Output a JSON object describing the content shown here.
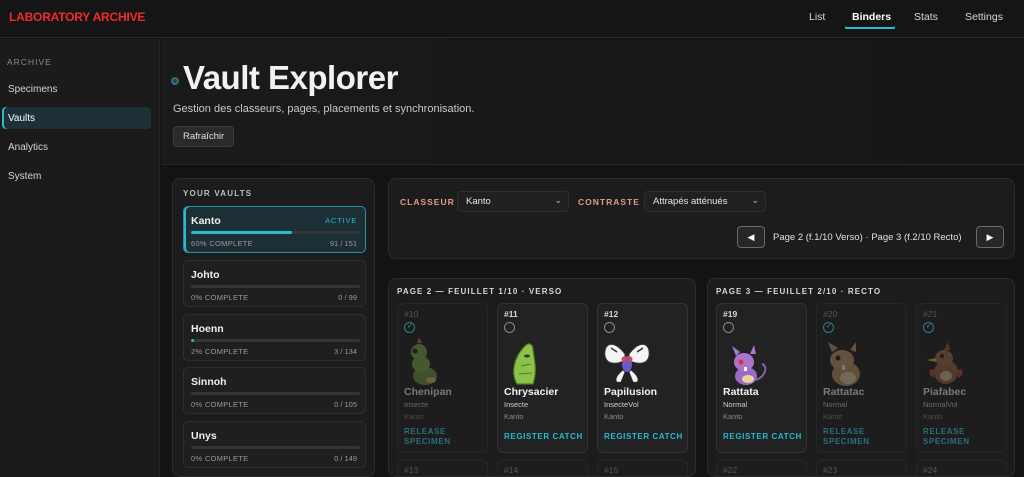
{
  "brand": "LABORATORY ARCHIVE",
  "nav": [
    {
      "label": "List",
      "active": false
    },
    {
      "label": "Binders",
      "active": true
    },
    {
      "label": "Stats",
      "active": false
    },
    {
      "label": "Settings",
      "active": false
    }
  ],
  "sidebar": {
    "heading": "ARCHIVE",
    "items": [
      {
        "label": "Specimens",
        "active": false
      },
      {
        "label": "Vaults",
        "active": true
      },
      {
        "label": "Analytics",
        "active": false
      },
      {
        "label": "System",
        "active": false
      }
    ]
  },
  "header": {
    "title": "Vault Explorer",
    "subtitle": "Gestion des classeurs, pages, placements et synchronisation.",
    "refresh_label": "Rafraîchir"
  },
  "vaults": {
    "heading": "YOUR VAULTS",
    "active_badge": "ACTIVE",
    "items": [
      {
        "name": "Kanto",
        "active": true,
        "progress": 0.6,
        "pct_label": "60% COMPLETE",
        "count": "91 / 151"
      },
      {
        "name": "Johto",
        "active": false,
        "progress": 0.0,
        "pct_label": "0% COMPLETE",
        "count": "0 / 99"
      },
      {
        "name": "Hoenn",
        "active": false,
        "progress": 0.02,
        "pct_label": "2% COMPLETE",
        "count": "3 / 134"
      },
      {
        "name": "Sinnoh",
        "active": false,
        "progress": 0.0,
        "pct_label": "0% COMPLETE",
        "count": "0 / 105"
      },
      {
        "name": "Unys",
        "active": false,
        "progress": 0.0,
        "pct_label": "0% COMPLETE",
        "count": "0 / 149"
      }
    ]
  },
  "controls": {
    "binder_label": "CLASSEUR",
    "binder_value": "Kanto",
    "contrast_label": "CONTRASTE",
    "contrast_value": "Attrapés atténués",
    "prev_icon": "◀",
    "next_icon": "▶",
    "page_indicator": "Page 2 (f.1/10 Verso) · Page 3 (f.2/10 Recto)"
  },
  "pages": [
    {
      "title": "PAGE 2 — FEUILLET 1/10 · VERSO",
      "cards": [
        {
          "num": "#10",
          "name": "Chenipan",
          "type": "Insecte",
          "region": "Kanto",
          "action": "RELEASE SPECIMEN",
          "caught": true,
          "icon": "caterpie-sprite"
        },
        {
          "num": "#11",
          "name": "Chrysacier",
          "type": "Insecte",
          "region": "Kanto",
          "action": "REGISTER CATCH",
          "caught": false,
          "icon": "metapod-sprite"
        },
        {
          "num": "#12",
          "name": "Papilusion",
          "type": "InsecteVol",
          "region": "Kanto",
          "action": "REGISTER CATCH",
          "caught": false,
          "icon": "butterfree-sprite"
        }
      ],
      "bottom_nums": [
        "#13",
        "#14",
        "#15"
      ]
    },
    {
      "title": "PAGE 3 — FEUILLET 2/10 · RECTO",
      "cards": [
        {
          "num": "#19",
          "name": "Rattata",
          "type": "Normal",
          "region": "Kanto",
          "action": "REGISTER CATCH",
          "caught": false,
          "icon": "rattata-sprite"
        },
        {
          "num": "#20",
          "name": "Rattatac",
          "type": "Normal",
          "region": "Kanto",
          "action": "RELEASE SPECIMEN",
          "caught": true,
          "icon": "raticate-sprite"
        },
        {
          "num": "#21",
          "name": "Piafabec",
          "type": "NormalVol",
          "region": "Kanto",
          "action": "RELEASE SPECIMEN",
          "caught": true,
          "icon": "spearow-sprite"
        }
      ],
      "bottom_nums": [
        "#22",
        "#23",
        "#24"
      ]
    }
  ],
  "colors": {
    "accent": "#2bb9d4",
    "brand": "#ef2b2b",
    "label": "#e39a8a"
  }
}
